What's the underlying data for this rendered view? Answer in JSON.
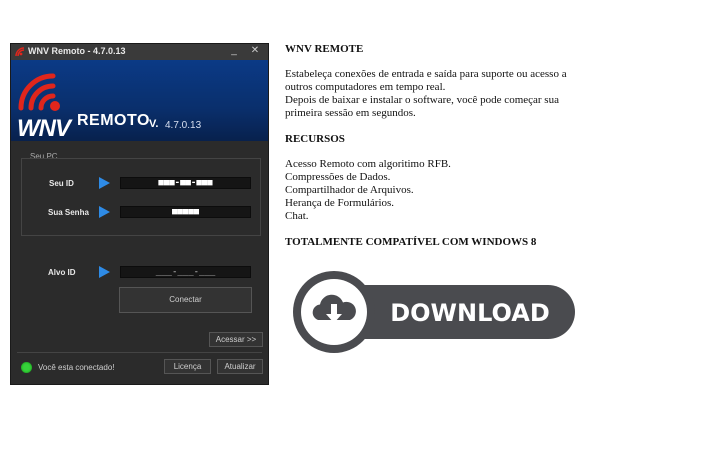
{
  "window": {
    "title": "WNV Remoto - 4.7.0.13",
    "minimize": "_",
    "close": "✕"
  },
  "banner": {
    "logo_text": "WNV",
    "product": "REMOTO",
    "v": "V.",
    "version": "4.7.0.13"
  },
  "form": {
    "group_label": "Seu PC",
    "seu_id_label": "Seu ID",
    "seu_id_value": "■■■-■■-■■■",
    "senha_label": "Sua Senha",
    "senha_value": "■■■■■",
    "alvo_id_label": "Alvo ID",
    "alvo_id_value": "___-___-___",
    "connect_button": "Conectar",
    "acessar_button": "Acessar >>"
  },
  "status": {
    "text": "Você esta conectado!",
    "licenca_button": "Licença",
    "atualizar_button": "Atualizar",
    "dot_color": "#36d33a"
  },
  "article": {
    "title": "WNV REMOTE",
    "intro_lines": [
      "Estabeleça conexões de entrada e saída para suporte ou acesso a",
      "outros computadores em tempo real.",
      "Depois de baixar e instalar o software, você pode começar sua",
      "primeira sessão em segundos."
    ],
    "resources_title": "RECURSOS",
    "resources": [
      "Acesso Remoto com algoritimo RFB.",
      "Compressões de Dados.",
      "Compartilhador de Arquivos.",
      "Herança de Formulários.",
      "Chat."
    ],
    "compat": "TOTALMENTE COMPATÍVEL COM WINDOWS 8",
    "download_label": "DOWNLOAD"
  },
  "colors": {
    "accent_blue": "#2e8be6",
    "banner_blue": "#0b3a86",
    "logo_red": "#e0261c",
    "download_dark": "#4a4b4f"
  },
  "icons": [
    "wnv-logo-icon",
    "minimize-icon",
    "close-icon",
    "arrow-right-icon",
    "status-dot-icon",
    "cloud-download-icon"
  ]
}
